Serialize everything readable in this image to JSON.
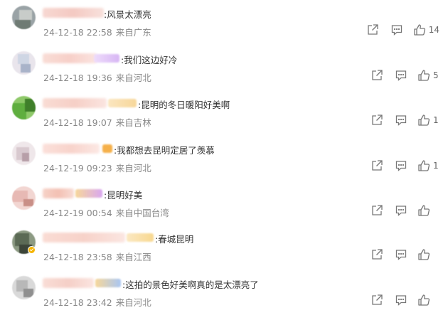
{
  "comments": [
    {
      "text": ":风景太漂亮",
      "time": "24-12-18 22:58",
      "location": "来自广东",
      "likes": "14",
      "avatar_colors": [
        "#9aa3a6",
        "#c8ccc9",
        "#6f7b74"
      ],
      "name_color": "#f4c9c2",
      "tag_color": "",
      "verified": false
    },
    {
      "text": ":我们这边好冷",
      "time": "24-12-18 19:36",
      "location": "来自河北",
      "likes": "5",
      "avatar_colors": [
        "#cfd6e4",
        "#e9e5ec",
        "#a9b3c9"
      ],
      "name_color": "#f7cfc8",
      "tag_color": "#d7b6f4",
      "verified": false
    },
    {
      "text": ":昆明的冬日暖阳好美啊",
      "time": "24-12-18 19:07",
      "location": "来自吉林",
      "likes": "1",
      "avatar_colors": [
        "#5fae3f",
        "#3f7f2a",
        "#8fc96a"
      ],
      "name_color": "#f6cfc6",
      "tag_color": "#f7d79a",
      "verified": false
    },
    {
      "text": ":我都想去昆明定居了羡慕",
      "time": "24-12-19 09:23",
      "location": "来自河北",
      "likes": "1",
      "avatar_colors": [
        "#d8c9cf",
        "#efe7ea",
        "#b79fa8"
      ],
      "name_color": "#f8d3cb",
      "tag_color": "#f5b04a",
      "verified": false
    },
    {
      "text": ":昆明好美",
      "time": "24-12-19 00:54",
      "location": "来自中国台湾",
      "likes": "",
      "avatar_colors": [
        "#e7b9b4",
        "#f2d6d2",
        "#c98f87"
      ],
      "name_color": "#f3c0b3",
      "tag_color": "#d9a7f0",
      "verified": false
    },
    {
      "text": ":春城昆明",
      "time": "24-12-18 23:58",
      "location": "来自江西",
      "likes": "",
      "avatar_colors": [
        "#5b6a55",
        "#8c9a83",
        "#3c4538"
      ],
      "name_color": "#f7d2c9",
      "tag_color": "#f8d890",
      "verified": true
    },
    {
      "text": ":这拍的景色好美啊真的是太漂亮了",
      "time": "24-12-18 23:42",
      "location": "来自河北",
      "likes": "",
      "avatar_colors": [
        "#b8b8b8",
        "#d9d9d9",
        "#8f8f8f"
      ],
      "name_color": "#f5cfc7",
      "tag_color": "#a9c6f2",
      "verified": false
    }
  ]
}
